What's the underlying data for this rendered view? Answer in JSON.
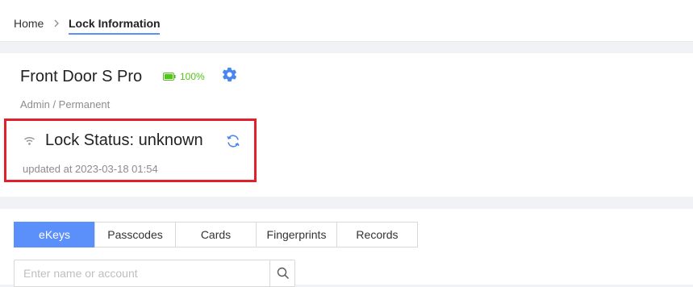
{
  "breadcrumb": {
    "home": "Home",
    "current": "Lock Information"
  },
  "lock": {
    "name": "Front Door S Pro",
    "battery": "100%",
    "role": "Admin / Permanent",
    "status_title": "Lock Status: unknown",
    "updated": "updated at 2023-03-18 01:54"
  },
  "tabs": [
    "eKeys",
    "Passcodes",
    "Cards",
    "Fingerprints",
    "Records"
  ],
  "active_tab": "eKeys",
  "search": {
    "placeholder": "Enter name or account",
    "value": ""
  },
  "icons": {
    "battery": "battery-full-icon",
    "settings": "gear-icon",
    "signal": "wifi-icon",
    "refresh": "refresh-icon",
    "search": "search-icon",
    "separator": "chevron-right-icon"
  },
  "colors": {
    "accent": "#5b8ff9",
    "battery": "#52c41a",
    "highlight": "#e0202a"
  }
}
